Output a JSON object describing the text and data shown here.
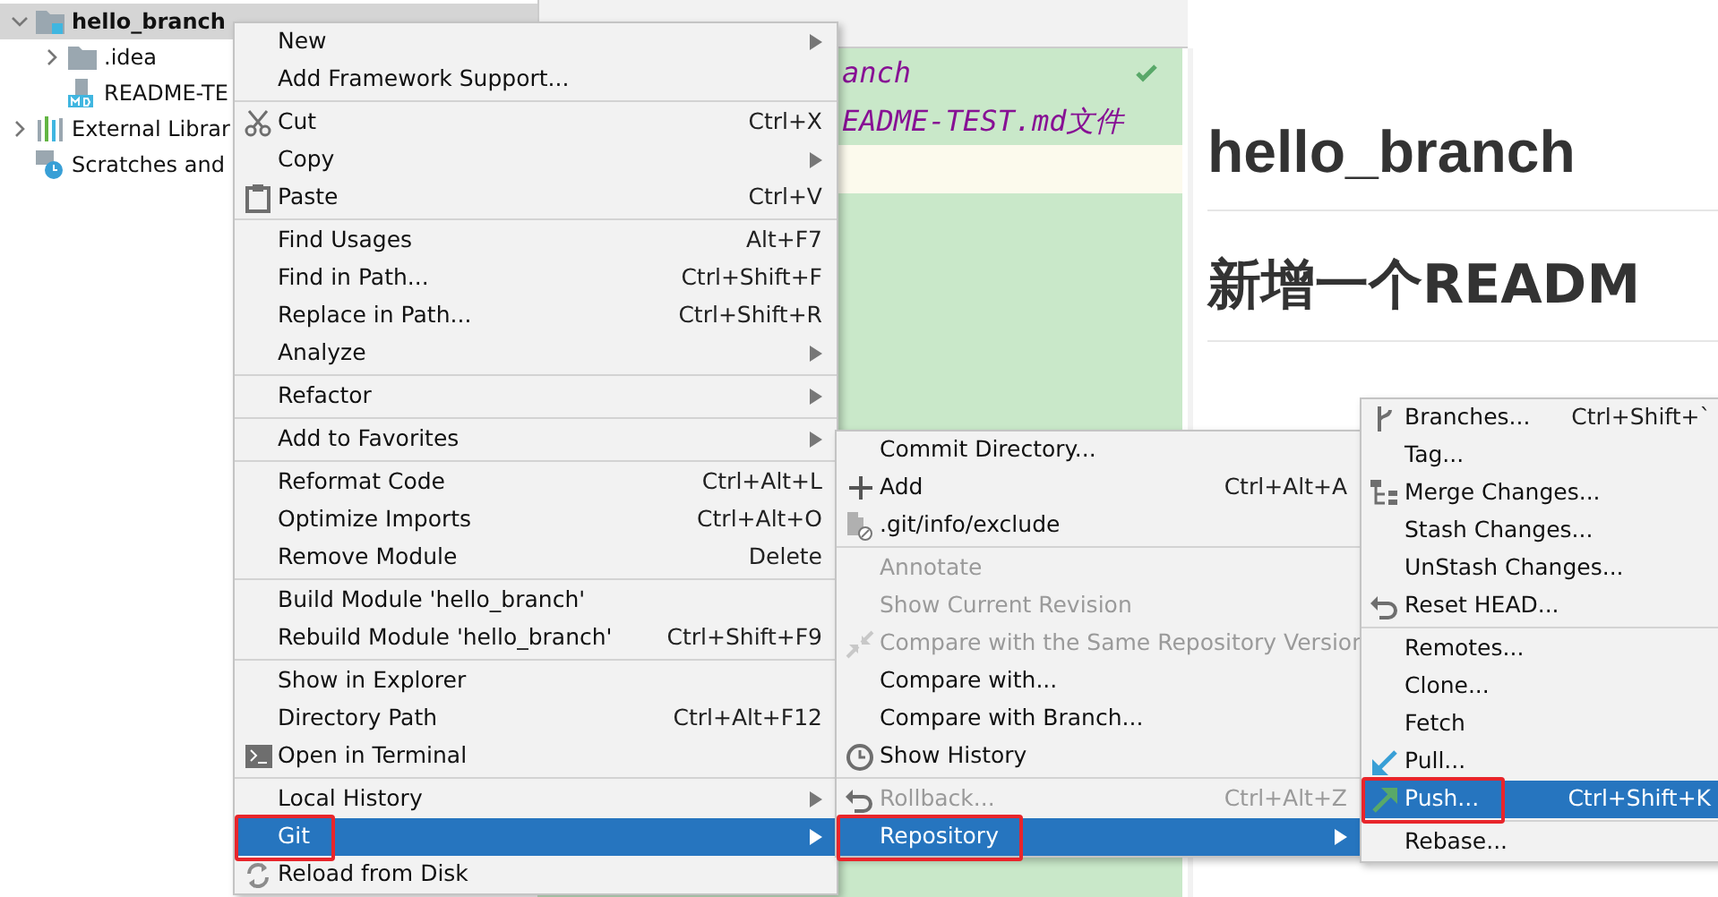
{
  "project_tree": {
    "items": [
      {
        "label": "hello_branch",
        "kind": "project",
        "expanded": true,
        "selected": true,
        "children": [
          {
            "label": ".idea",
            "kind": "folder",
            "expanded": false,
            "selected": false
          },
          {
            "label": "README-TE",
            "kind": "markdown",
            "selected": false
          }
        ]
      },
      {
        "label": "External Librar",
        "kind": "library",
        "expanded": false,
        "selected": false
      },
      {
        "label": "Scratches and",
        "kind": "scratches",
        "selected": false
      }
    ]
  },
  "editor": {
    "lines": [
      {
        "text": "anch",
        "current": false,
        "check": true
      },
      {
        "text": "EADME-TEST.md文件",
        "current": false,
        "check": false
      },
      {
        "current": true,
        "check": false
      }
    ]
  },
  "preview": {
    "heading": "hello_branch",
    "subheading": "新增一个READM"
  },
  "context_menu": {
    "items": [
      {
        "kind": "item",
        "label": "New",
        "submenu": true
      },
      {
        "kind": "item",
        "label": "Add Framework Support..."
      },
      {
        "kind": "separator"
      },
      {
        "kind": "cut",
        "label": "Cut",
        "shortcut": "Ctrl+X"
      },
      {
        "kind": "item",
        "label": "Copy",
        "submenu": true
      },
      {
        "kind": "paste",
        "label": "Paste",
        "shortcut": "Ctrl+V"
      },
      {
        "kind": "separator"
      },
      {
        "kind": "item",
        "label": "Find Usages",
        "shortcut": "Alt+F7"
      },
      {
        "kind": "item",
        "label": "Find in Path...",
        "shortcut": "Ctrl+Shift+F"
      },
      {
        "kind": "item",
        "label": "Replace in Path...",
        "shortcut": "Ctrl+Shift+R"
      },
      {
        "kind": "item",
        "label": "Analyze",
        "submenu": true
      },
      {
        "kind": "separator"
      },
      {
        "kind": "item",
        "label": "Refactor",
        "submenu": true
      },
      {
        "kind": "separator"
      },
      {
        "kind": "item",
        "label": "Add to Favorites",
        "submenu": true
      },
      {
        "kind": "separator"
      },
      {
        "kind": "item",
        "label": "Reformat Code",
        "shortcut": "Ctrl+Alt+L"
      },
      {
        "kind": "item",
        "label": "Optimize Imports",
        "shortcut": "Ctrl+Alt+O"
      },
      {
        "kind": "item",
        "label": "Remove Module",
        "shortcut": "Delete"
      },
      {
        "kind": "separator"
      },
      {
        "kind": "item",
        "label": "Build Module 'hello_branch'"
      },
      {
        "kind": "item",
        "label": "Rebuild Module 'hello_branch'",
        "shortcut": "Ctrl+Shift+F9"
      },
      {
        "kind": "separator"
      },
      {
        "kind": "item",
        "label": "Show in Explorer"
      },
      {
        "kind": "item",
        "label": "Directory Path",
        "shortcut": "Ctrl+Alt+F12"
      },
      {
        "kind": "terminal",
        "label": "Open in Terminal"
      },
      {
        "kind": "separator"
      },
      {
        "kind": "item",
        "label": "Local History",
        "submenu": true
      },
      {
        "kind": "item",
        "label": "Git",
        "submenu": true,
        "selected": true,
        "highlighted": true
      },
      {
        "kind": "reload",
        "label": "Reload from Disk"
      }
    ]
  },
  "git_menu": {
    "items": [
      {
        "kind": "item",
        "label": "Commit Directory..."
      },
      {
        "kind": "plus",
        "label": "Add",
        "shortcut": "Ctrl+Alt+A"
      },
      {
        "kind": "file",
        "label": ".git/info/exclude"
      },
      {
        "kind": "separator"
      },
      {
        "kind": "item",
        "label": "Annotate",
        "disabled": true
      },
      {
        "kind": "item",
        "label": "Show Current Revision",
        "disabled": true
      },
      {
        "kind": "compare",
        "label": "Compare with the Same Repository Version",
        "disabled": true
      },
      {
        "kind": "item",
        "label": "Compare with..."
      },
      {
        "kind": "item",
        "label": "Compare with Branch..."
      },
      {
        "kind": "clock",
        "label": "Show History"
      },
      {
        "kind": "separator"
      },
      {
        "kind": "undo",
        "label": "Rollback...",
        "shortcut": "Ctrl+Alt+Z",
        "disabled": true
      },
      {
        "kind": "item",
        "label": "Repository",
        "submenu": true,
        "selected": true,
        "highlighted": true
      }
    ]
  },
  "repository_menu": {
    "items": [
      {
        "kind": "branch",
        "label": "Branches...",
        "shortcut": "Ctrl+Shift+`"
      },
      {
        "kind": "item",
        "label": "Tag..."
      },
      {
        "kind": "merge",
        "label": "Merge Changes..."
      },
      {
        "kind": "item",
        "label": "Stash Changes..."
      },
      {
        "kind": "item",
        "label": "UnStash Changes..."
      },
      {
        "kind": "undo",
        "label": "Reset HEAD..."
      },
      {
        "kind": "separator"
      },
      {
        "kind": "item",
        "label": "Remotes..."
      },
      {
        "kind": "item",
        "label": "Clone..."
      },
      {
        "kind": "item",
        "label": "Fetch"
      },
      {
        "kind": "pull",
        "label": "Pull..."
      },
      {
        "kind": "push",
        "label": "Push...",
        "shortcut": "Ctrl+Shift+K",
        "selected": true,
        "highlighted": true
      },
      {
        "kind": "separator"
      },
      {
        "kind": "item",
        "label": "Rebase..."
      }
    ]
  }
}
